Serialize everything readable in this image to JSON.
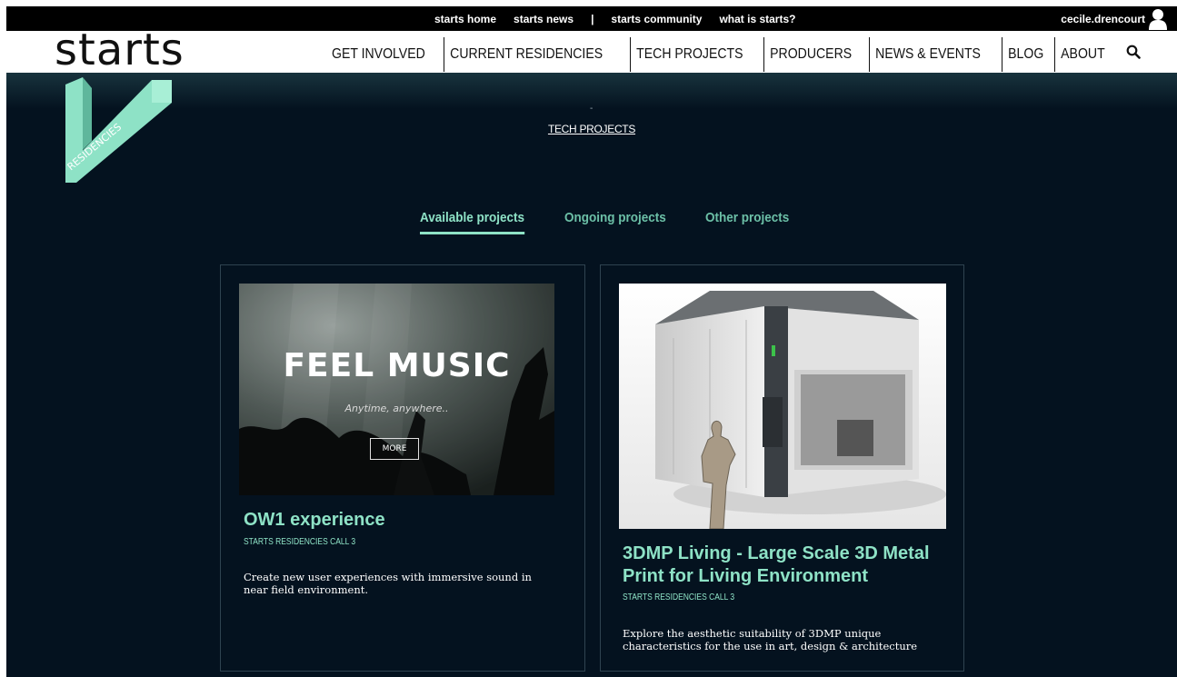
{
  "topbar": {
    "links": [
      "starts home",
      "starts news",
      "starts community",
      "what is starts?"
    ],
    "separator": "|",
    "user": "cecile.drencourt"
  },
  "header": {
    "logo": "starts",
    "nav": [
      "GET INVOLVED",
      "CURRENT RESIDENCIES",
      "TECH PROJECTS",
      "PRODUCERS",
      "NEWS & EVENTS",
      "BLOG",
      "ABOUT"
    ]
  },
  "page": {
    "dash": "-",
    "breadcrumb": "TECH PROJECTS",
    "residencies_logo_text": "RESIDENCIES"
  },
  "tabs": [
    {
      "label": "Available projects",
      "active": true
    },
    {
      "label": "Ongoing projects",
      "active": false
    },
    {
      "label": "Other projects",
      "active": false
    }
  ],
  "cards": [
    {
      "image_title": "FEEL MUSIC",
      "image_subtitle": "Anytime, anywhere..",
      "image_button": "MORE",
      "title": "OW1 experience",
      "subtitle": "STARTS RESIDENCIES CALL 3",
      "description": "Create new user experiences with immersive sound in near field environment."
    },
    {
      "title": "3DMP Living - Large Scale 3D Metal Print for Living Environment",
      "subtitle": "STARTS RESIDENCIES CALL 3",
      "description": "Explore the aesthetic suitability of 3DMP unique characteristics for the use in art, design & architecture"
    }
  ],
  "colors": {
    "accent": "#8ee2c6",
    "accent_dim": "#6cc0a7",
    "background": "#04121f",
    "topbar": "#000000"
  },
  "icons": [
    "user-icon",
    "search-icon"
  ]
}
